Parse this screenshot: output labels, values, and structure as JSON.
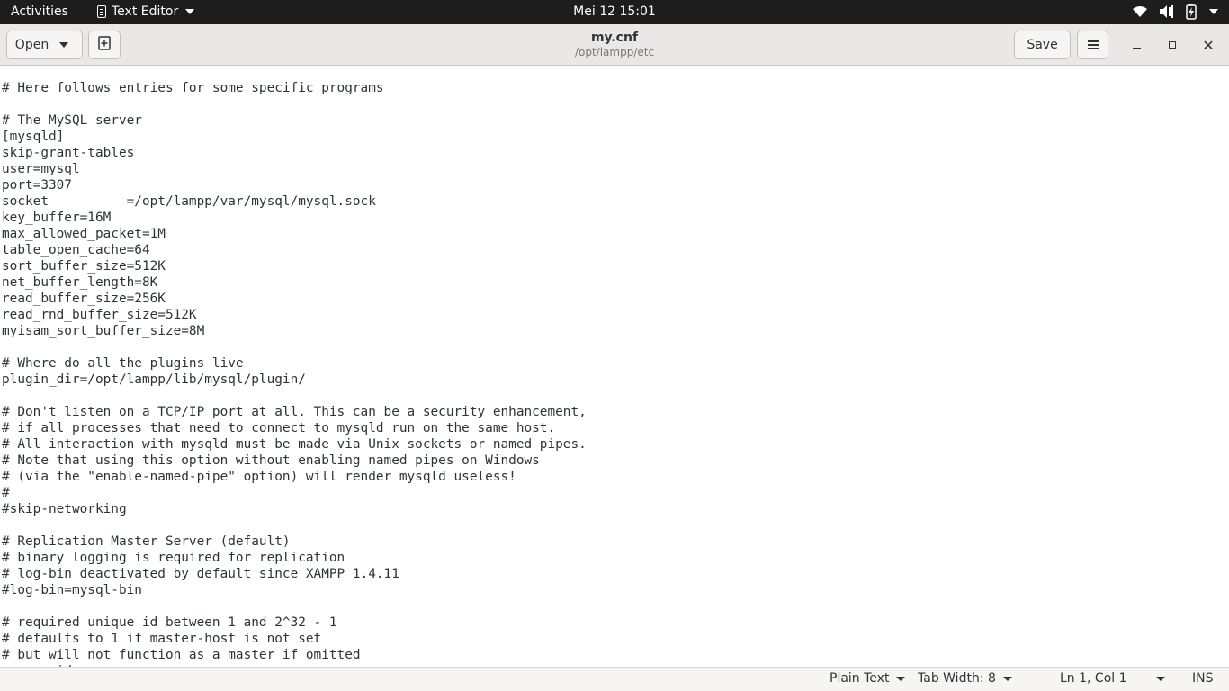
{
  "topbar": {
    "activities": "Activities",
    "app_name": "Text Editor",
    "clock": "Mei 12  15:01",
    "tray_icons": [
      "wifi-icon",
      "volume-icon",
      "battery-icon",
      "system-menu-chevron-icon"
    ]
  },
  "header": {
    "open_label": "Open",
    "file_name": "my.cnf",
    "file_path": "/opt/lampp/etc",
    "save_label": "Save",
    "icons": [
      "new-document-icon",
      "hamburger-menu-icon",
      "minimize-icon",
      "maximize-icon",
      "close-icon"
    ]
  },
  "editor": {
    "lines": [
      "# Here follows entries for some specific programs",
      "",
      "# The MySQL server",
      "[mysqld]",
      "skip-grant-tables",
      "user=mysql",
      "port=3307",
      "socket          =/opt/lampp/var/mysql/mysql.sock",
      "key_buffer=16M",
      "max_allowed_packet=1M",
      "table_open_cache=64",
      "sort_buffer_size=512K",
      "net_buffer_length=8K",
      "read_buffer_size=256K",
      "read_rnd_buffer_size=512K",
      "myisam_sort_buffer_size=8M",
      "",
      "# Where do all the plugins live",
      "plugin_dir=/opt/lampp/lib/mysql/plugin/",
      "",
      "# Don't listen on a TCP/IP port at all. This can be a security enhancement,",
      "# if all processes that need to connect to mysqld run on the same host.",
      "# All interaction with mysqld must be made via Unix sockets or named pipes.",
      "# Note that using this option without enabling named pipes on Windows",
      "# (via the \"enable-named-pipe\" option) will render mysqld useless!",
      "#",
      "#skip-networking",
      "",
      "# Replication Master Server (default)",
      "# binary logging is required for replication",
      "# log-bin deactivated by default since XAMPP 1.4.11",
      "#log-bin=mysql-bin",
      "",
      "# required unique id between 1 and 2^32 - 1",
      "# defaults to 1 if master-host is not set",
      "# but will not function as a master if omitted",
      "server-id"
    ]
  },
  "statusbar": {
    "language": "Plain Text",
    "tab_width": "Tab Width: 8",
    "cursor": "Ln 1, Col 1",
    "mode": "INS"
  }
}
